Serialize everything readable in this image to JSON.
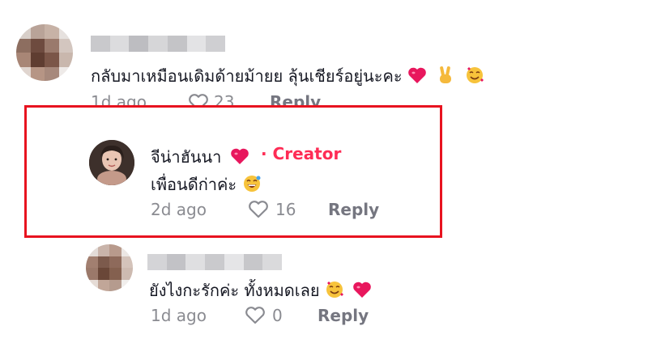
{
  "comments": [
    {
      "text": "กลับมาเหมือนเดิมด้ายม้ายย ลุ้นเชียร์อยู่นะคะ",
      "time": "1d ago",
      "likes": "23",
      "reply_label": "Reply"
    },
    {
      "author": "จีน่าฮันนา",
      "creator_tag": "· Creator",
      "text": "เพื่อนดีก่าค่ะ",
      "time": "2d ago",
      "likes": "16",
      "reply_label": "Reply"
    },
    {
      "text": "ยังไงกะรักค่ะ ทั้งหมดเลย",
      "time": "1d ago",
      "likes": "0",
      "reply_label": "Reply"
    }
  ],
  "colors": {
    "creator_accent": "#fe2c55",
    "highlight_border": "#e8131f",
    "heart_emoji": "#e8175d"
  },
  "icons": [
    "heart-outline-icon",
    "heart-emoji-icon",
    "victory-hand-emoji-icon",
    "smiling-face-with-hearts-emoji-icon",
    "grinning-emoji-icon"
  ]
}
